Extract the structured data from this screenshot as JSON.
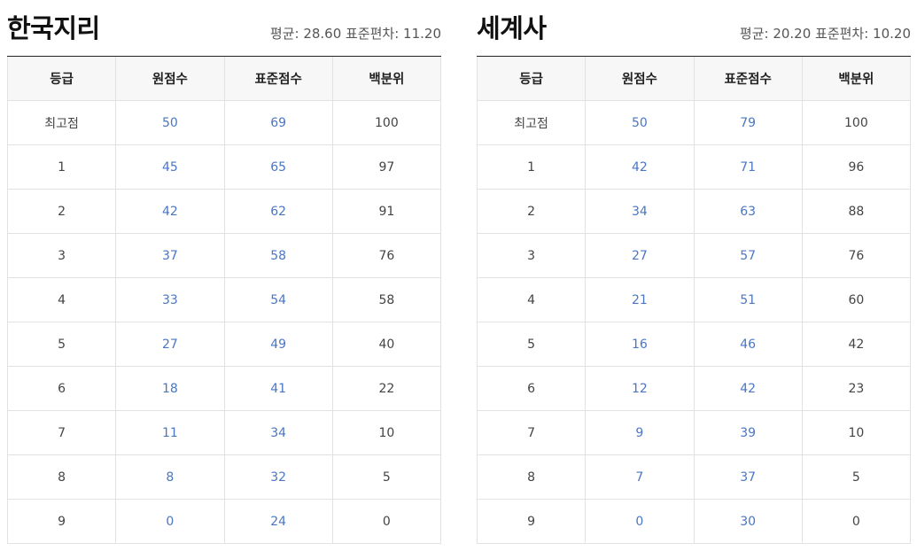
{
  "tables": [
    {
      "title": "한국지리",
      "stats": "평균: 28.60 표준편차: 11.20",
      "headers": [
        "등급",
        "원점수",
        "표준점수",
        "백분위"
      ],
      "rows": [
        {
          "grade": "최고점",
          "raw": "50",
          "standard": "69",
          "percentile": "100"
        },
        {
          "grade": "1",
          "raw": "45",
          "standard": "65",
          "percentile": "97"
        },
        {
          "grade": "2",
          "raw": "42",
          "standard": "62",
          "percentile": "91"
        },
        {
          "grade": "3",
          "raw": "37",
          "standard": "58",
          "percentile": "76"
        },
        {
          "grade": "4",
          "raw": "33",
          "standard": "54",
          "percentile": "58"
        },
        {
          "grade": "5",
          "raw": "27",
          "standard": "49",
          "percentile": "40"
        },
        {
          "grade": "6",
          "raw": "18",
          "standard": "41",
          "percentile": "22"
        },
        {
          "grade": "7",
          "raw": "11",
          "standard": "34",
          "percentile": "10"
        },
        {
          "grade": "8",
          "raw": "8",
          "standard": "32",
          "percentile": "5"
        },
        {
          "grade": "9",
          "raw": "0",
          "standard": "24",
          "percentile": "0"
        }
      ]
    },
    {
      "title": "세계사",
      "stats": "평균: 20.20 표준편차: 10.20",
      "headers": [
        "등급",
        "원점수",
        "표준점수",
        "백분위"
      ],
      "rows": [
        {
          "grade": "최고점",
          "raw": "50",
          "standard": "79",
          "percentile": "100"
        },
        {
          "grade": "1",
          "raw": "42",
          "standard": "71",
          "percentile": "96"
        },
        {
          "grade": "2",
          "raw": "34",
          "standard": "63",
          "percentile": "88"
        },
        {
          "grade": "3",
          "raw": "27",
          "standard": "57",
          "percentile": "76"
        },
        {
          "grade": "4",
          "raw": "21",
          "standard": "51",
          "percentile": "60"
        },
        {
          "grade": "5",
          "raw": "16",
          "standard": "46",
          "percentile": "42"
        },
        {
          "grade": "6",
          "raw": "12",
          "standard": "42",
          "percentile": "23"
        },
        {
          "grade": "7",
          "raw": "9",
          "standard": "39",
          "percentile": "10"
        },
        {
          "grade": "8",
          "raw": "7",
          "standard": "37",
          "percentile": "5"
        },
        {
          "grade": "9",
          "raw": "0",
          "standard": "30",
          "percentile": "0"
        }
      ]
    }
  ],
  "colors": {
    "link_blue": "#4a76c4",
    "header_bg": "#f7f7f7",
    "border": "#e2e2e2"
  }
}
